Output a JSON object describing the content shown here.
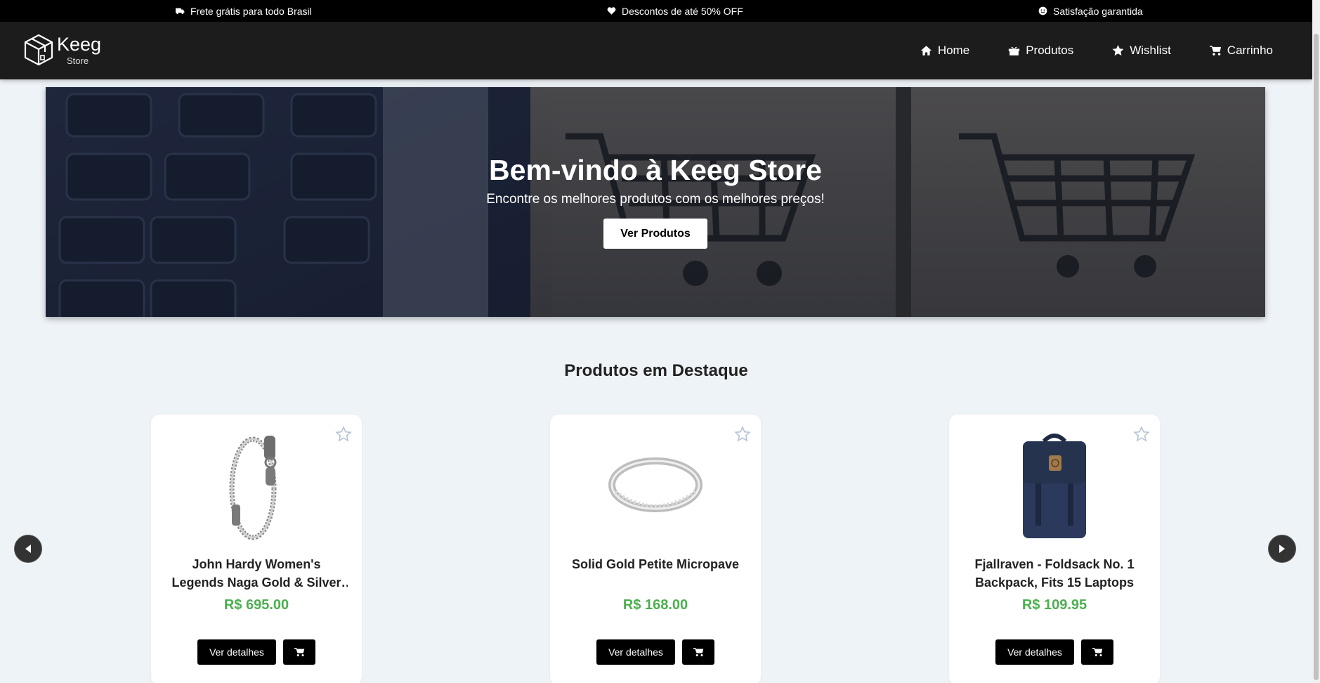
{
  "promo": {
    "items": [
      {
        "icon": "truck-icon",
        "label": "Frete grátis para todo Brasil"
      },
      {
        "icon": "heart-icon",
        "label": "Descontos de até 50% OFF"
      },
      {
        "icon": "smile-icon",
        "label": "Satisfação garantida"
      }
    ]
  },
  "header": {
    "logo": {
      "name": "Keeg",
      "sub": "Store"
    },
    "nav": [
      {
        "icon": "home-icon",
        "label": "Home"
      },
      {
        "icon": "gift-icon",
        "label": "Produtos"
      },
      {
        "icon": "star-icon",
        "label": "Wishlist"
      },
      {
        "icon": "cart-icon",
        "label": "Carrinho"
      }
    ]
  },
  "hero": {
    "title": "Bem-vindo à Keeg Store",
    "subtitle": "Encontre os melhores produtos com os melhores preços!",
    "button_label": "Ver Produtos"
  },
  "featured": {
    "title": "Produtos em Destaque",
    "products": [
      {
        "name": "John Hardy Women's Legends Naga Gold & Silver Dragon Station Chain Bracelet",
        "price": "R$ 695.00",
        "image": "bracelet",
        "details_label": "Ver detalhes"
      },
      {
        "name": "Solid Gold Petite Micropave",
        "price": "R$ 168.00",
        "image": "ring",
        "details_label": "Ver detalhes"
      },
      {
        "name": "Fjallraven - Foldsack No. 1 Backpack, Fits 15 Laptops",
        "price": "R$ 109.95",
        "image": "backpack",
        "details_label": "Ver detalhes"
      }
    ]
  },
  "colors": {
    "price": "#4caf50",
    "header_bg": "#1c1c1c",
    "page_bg": "#eef3f8"
  }
}
